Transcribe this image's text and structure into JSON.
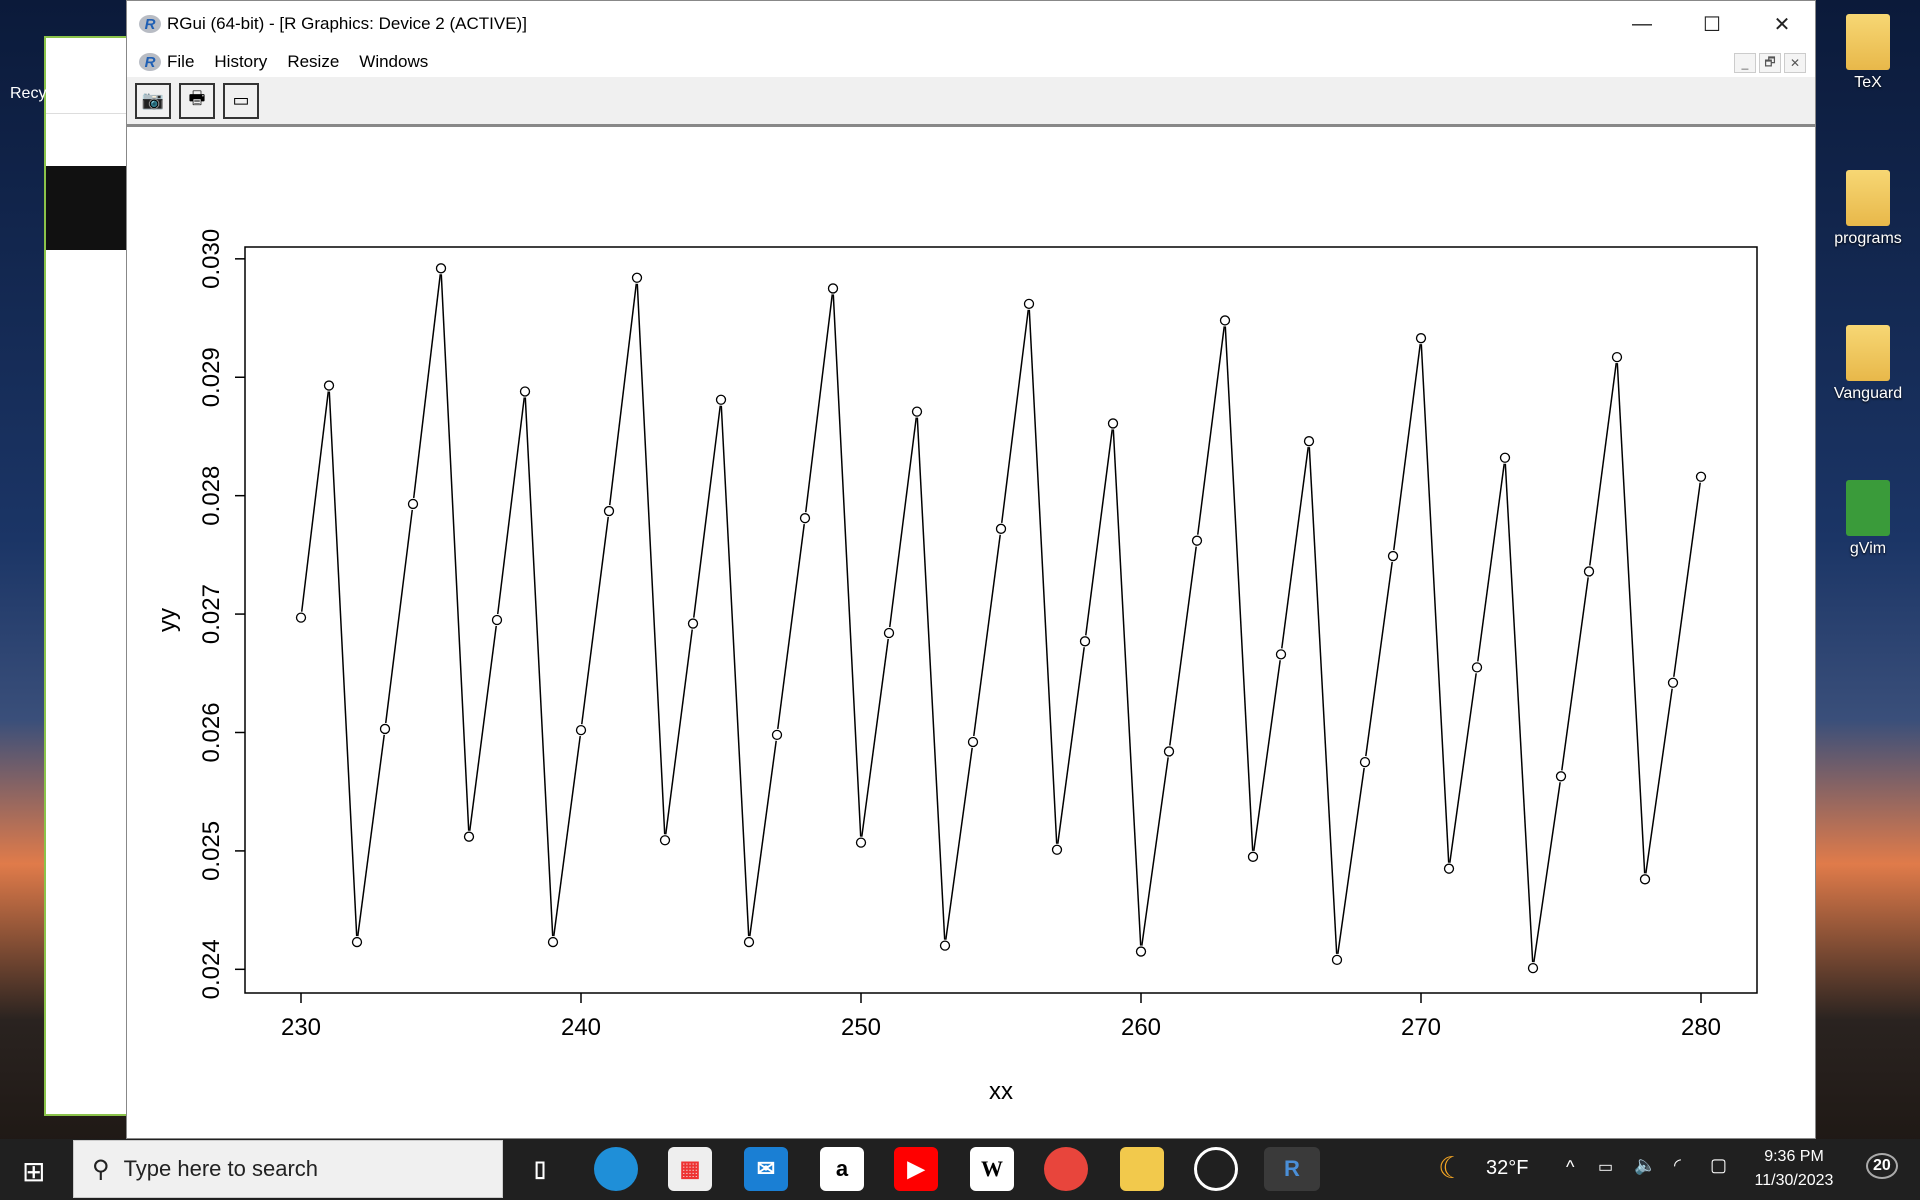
{
  "window": {
    "title": "RGui (64-bit) - [R Graphics: Device 2 (ACTIVE)]",
    "minimize": "—",
    "maximize": "☐",
    "close": "✕",
    "mdi": [
      "_",
      "🗗",
      "✕"
    ]
  },
  "menu": [
    "File",
    "History",
    "Resize",
    "Windows"
  ],
  "toolbar": [
    {
      "icon": "camera-icon",
      "glyph": "📷"
    },
    {
      "icon": "printer-icon",
      "glyph": "🖶"
    },
    {
      "icon": "console-window-icon",
      "glyph": "▭"
    }
  ],
  "desktop": {
    "icons": [
      "TeX",
      "programs",
      "Vanguard",
      "gVim"
    ],
    "recycle": "Recy"
  },
  "taskbar": {
    "search_placeholder": "Type here to search",
    "weather": "32°F",
    "time": "9:36 PM",
    "date": "11/30/2023",
    "notifications": "20"
  },
  "chart_data": {
    "type": "line",
    "plot_type": "b",
    "xlabel": "xx",
    "ylabel": "yy",
    "xlim": [
      228,
      282
    ],
    "ylim": [
      0.0238,
      0.0301
    ],
    "xticks": [
      230,
      240,
      250,
      260,
      270,
      280
    ],
    "yticks": [
      "0.024",
      "0.025",
      "0.026",
      "0.027",
      "0.028",
      "0.029",
      "0.030"
    ],
    "x": [
      230,
      231,
      232,
      233,
      234,
      235,
      236,
      237,
      238,
      239,
      240,
      241,
      242,
      243,
      244,
      245,
      246,
      247,
      248,
      249,
      250,
      251,
      252,
      253,
      254,
      255,
      256,
      257,
      258,
      259,
      260,
      261,
      262,
      263,
      264,
      265,
      266,
      267,
      268,
      269,
      270,
      271,
      272,
      273,
      274,
      275,
      276,
      277,
      278,
      279,
      280
    ],
    "y": [
      0.02697,
      0.02893,
      0.02423,
      0.02603,
      0.02793,
      0.02992,
      0.02512,
      0.02695,
      0.02888,
      0.02423,
      0.02602,
      0.02787,
      0.02984,
      0.02509,
      0.02692,
      0.02881,
      0.02423,
      0.02598,
      0.02781,
      0.02975,
      0.02507,
      0.02684,
      0.02871,
      0.0242,
      0.02592,
      0.02772,
      0.02962,
      0.02501,
      0.02677,
      0.02861,
      0.02415,
      0.02584,
      0.02762,
      0.02948,
      0.02495,
      0.02666,
      0.02846,
      0.02408,
      0.02575,
      0.02749,
      0.02933,
      0.02485,
      0.02655,
      0.02832,
      0.02401,
      0.02563,
      0.02736,
      0.02917,
      0.02476,
      0.02642,
      0.02816
    ],
    "grid": false
  }
}
